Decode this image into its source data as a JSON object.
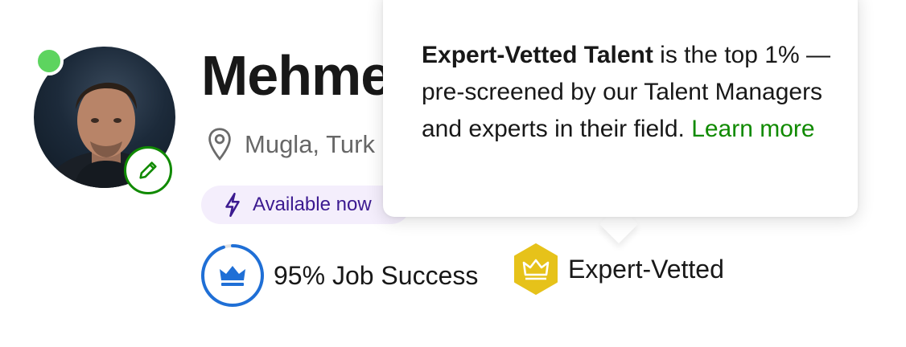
{
  "profile": {
    "name": "Mehme",
    "location": "Mugla, Turk",
    "availability": "Available now",
    "online": true
  },
  "stats": {
    "job_success": "95% Job Success",
    "job_success_percent": 95,
    "expert_vetted": "Expert-Vetted"
  },
  "tooltip": {
    "bold_title": "Expert-Vetted Talent",
    "body": " is the top 1% — pre-screened by our Talent Managers and experts in their field. ",
    "link_label": "Learn more"
  },
  "colors": {
    "brand_green": "#108a00",
    "online_green": "#5dd45f",
    "badge_bg": "#f4eefc",
    "badge_text": "#3c1a90",
    "jss_blue": "#1f6fd6",
    "expert_gold": "#e6c21a"
  },
  "icons": {
    "edit": "pencil-icon",
    "location": "location-pin-icon",
    "availability": "lightning-bolt-icon",
    "job_success": "crown-icon",
    "expert_vetted": "hexagon-crown-icon"
  }
}
